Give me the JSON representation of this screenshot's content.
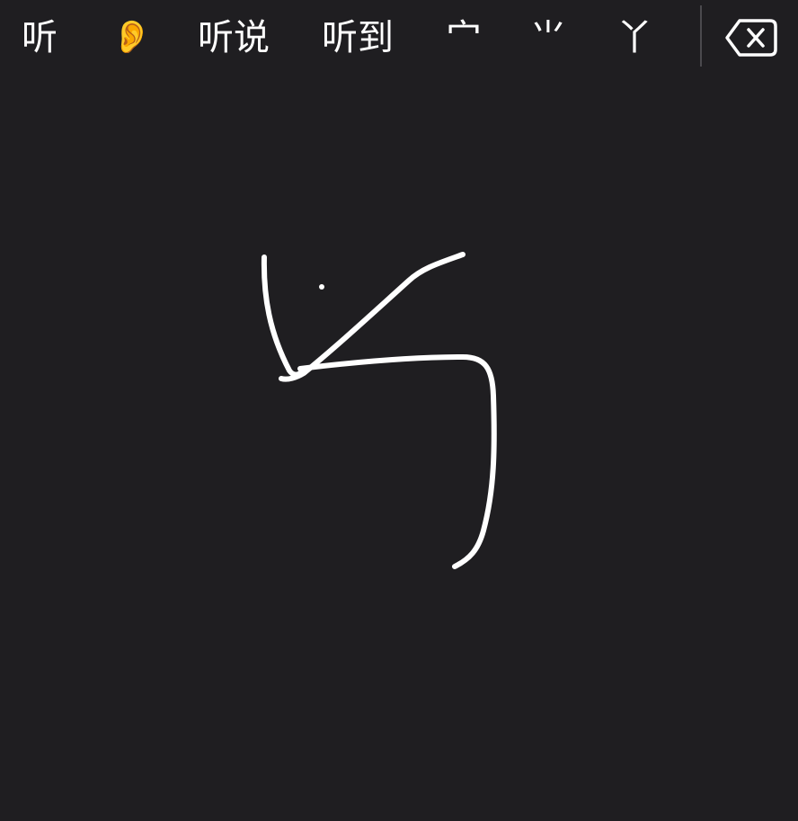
{
  "candidates": [
    {
      "text": "听"
    },
    {
      "text": "👂"
    },
    {
      "text": "听说"
    },
    {
      "text": "听到"
    },
    {
      "text": "宀"
    },
    {
      "text": "⺌"
    },
    {
      "text": "丫"
    }
  ],
  "icons": {
    "delete": "delete-backspace-icon"
  },
  "colors": {
    "background": "#1f1e21",
    "ink": "#ffffff",
    "divider": "#4a494d"
  }
}
